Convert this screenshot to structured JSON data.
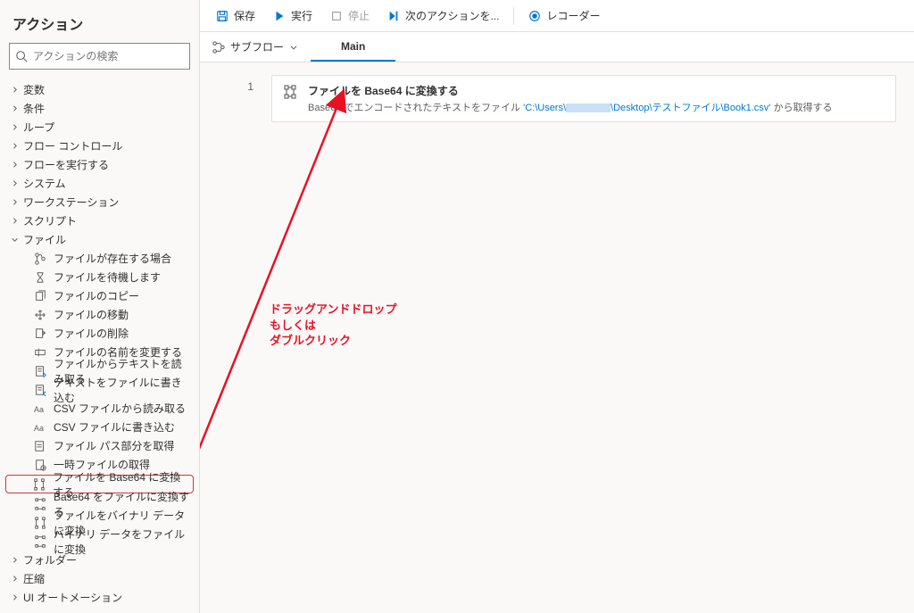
{
  "sidebar": {
    "title": "アクション",
    "search_placeholder": "アクションの検索",
    "groups": [
      {
        "label": "変数",
        "expanded": false
      },
      {
        "label": "条件",
        "expanded": false
      },
      {
        "label": "ループ",
        "expanded": false
      },
      {
        "label": "フロー コントロール",
        "expanded": false
      },
      {
        "label": "フローを実行する",
        "expanded": false
      },
      {
        "label": "システム",
        "expanded": false
      },
      {
        "label": "ワークステーション",
        "expanded": false
      },
      {
        "label": "スクリプト",
        "expanded": false
      },
      {
        "label": "ファイル",
        "expanded": true,
        "children": [
          {
            "icon": "branch",
            "label": "ファイルが存在する場合"
          },
          {
            "icon": "hourglass",
            "label": "ファイルを待機します"
          },
          {
            "icon": "copy",
            "label": "ファイルのコピー"
          },
          {
            "icon": "move",
            "label": "ファイルの移動"
          },
          {
            "icon": "delete",
            "label": "ファイルの削除"
          },
          {
            "icon": "rename",
            "label": "ファイルの名前を変更する"
          },
          {
            "icon": "readtext",
            "label": "ファイルからテキストを読み取る"
          },
          {
            "icon": "writetext",
            "label": "テキストをファイルに書き込む"
          },
          {
            "icon": "csvread",
            "label": "CSV ファイルから読み取る"
          },
          {
            "icon": "csvwrite",
            "label": "CSV ファイルに書き込む"
          },
          {
            "icon": "path",
            "label": "ファイル パス部分を取得"
          },
          {
            "icon": "temp",
            "label": "一時ファイルの取得"
          },
          {
            "icon": "b64enc",
            "label": "ファイルを Base64 に変換する",
            "highlighted": true
          },
          {
            "icon": "b64dec",
            "label": "Base64 をファイルに変換する"
          },
          {
            "icon": "binenc",
            "label": "ファイルをバイナリ データに変換"
          },
          {
            "icon": "bindec",
            "label": "バイナリ データをファイルに変換"
          }
        ]
      },
      {
        "label": "フォルダー",
        "expanded": false
      },
      {
        "label": "圧縮",
        "expanded": false
      },
      {
        "label": "UI オートメーション",
        "expanded": false
      }
    ]
  },
  "toolbar": {
    "save": "保存",
    "run": "実行",
    "stop": "停止",
    "next": "次のアクションを...",
    "recorder": "レコーダー"
  },
  "tabbar": {
    "subflow": "サブフロー",
    "main": "Main"
  },
  "step": {
    "num": "1",
    "title": "ファイルを Base64 に変換する",
    "desc_prefix": "Base64 でエンコードされたテキストをファイル ",
    "path_a": "'C:\\Users\\",
    "path_b": "\\Desktop\\テストファイル\\Book1.csv'",
    "desc_suffix": " から取得する"
  },
  "annotation": {
    "line1": "ドラッグアンドドロップ",
    "line2": "もしくは",
    "line3": "ダブルクリック"
  }
}
